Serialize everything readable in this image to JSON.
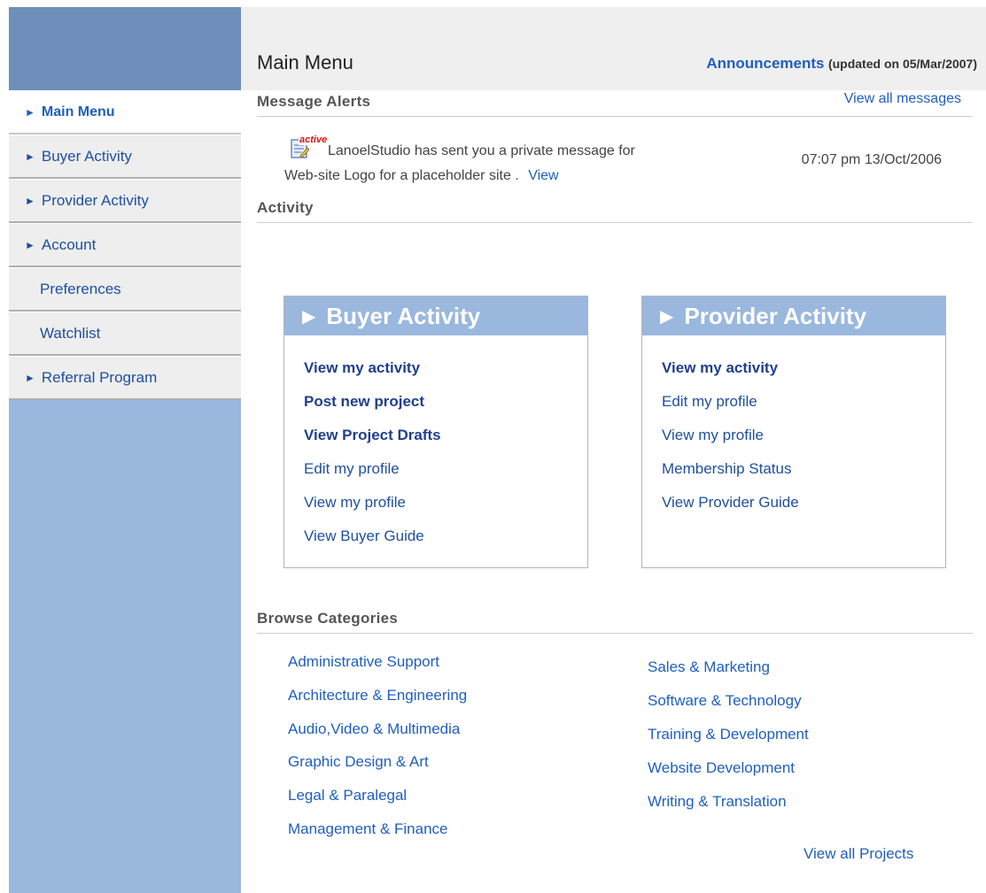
{
  "header": {
    "title": "Main Menu",
    "announcements_label": "Announcements",
    "announcements_note": "(updated on 05/Mar/2007)"
  },
  "sidebar": {
    "items": [
      {
        "label": "Main Menu",
        "arrow": "►"
      },
      {
        "label": "Buyer Activity",
        "arrow": "►"
      },
      {
        "label": "Provider Activity",
        "arrow": "►"
      },
      {
        "label": "Account",
        "arrow": "►"
      },
      {
        "label": "Preferences"
      },
      {
        "label": "Watchlist"
      },
      {
        "label": "Referral Program",
        "arrow": "►"
      }
    ]
  },
  "messages": {
    "title": "Message Alerts",
    "view_all": "View all messages",
    "alert": {
      "badge": "active",
      "line1": "LanoelStudio has sent you a private message for",
      "line2": "Web-site Logo for a placeholder site .",
      "view": "View",
      "time": "07:07 pm 13/Oct/2006"
    }
  },
  "activity": {
    "title": "Activity",
    "buyer": {
      "title": "Buyer Activity",
      "links": [
        "View my activity",
        "Post new project",
        "View Project Drafts",
        "Edit my profile",
        "View my profile",
        "View Buyer Guide"
      ]
    },
    "provider": {
      "title": "Provider Activity",
      "links": [
        "View my activity",
        "Edit my profile",
        "View my profile",
        "Membership Status",
        "View Provider Guide"
      ]
    }
  },
  "browse": {
    "title": "Browse Categories",
    "left": [
      "Administrative Support",
      "Architecture & Engineering",
      "Audio,Video & Multimedia",
      "Graphic Design & Art",
      "Legal & Paralegal",
      "Management & Finance"
    ],
    "right": [
      "Sales & Marketing",
      "Software & Technology",
      "Training & Development",
      "Website Development",
      "Writing & Translation"
    ],
    "view_all": "View all Projects"
  },
  "colors": {
    "sidebar_bg": "#9ab7de",
    "sidebar_head": "#6f8fba",
    "link": "#1f5fc0",
    "box_header": "#9ab7de"
  }
}
